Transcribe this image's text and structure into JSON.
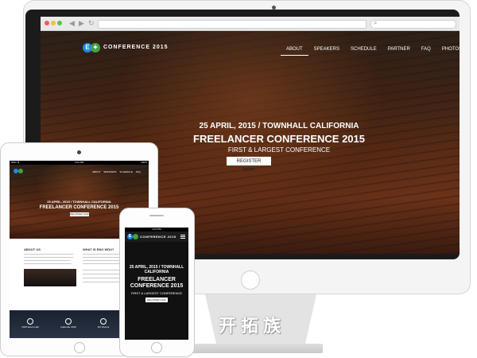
{
  "desktop": {
    "logo": {
      "badge": "E",
      "text": "CONFERENCE 2015"
    },
    "nav": [
      "ABOUT",
      "SPEAKERS",
      "SCHEDULE",
      "PARTNER",
      "FAQ",
      "PHOTOS"
    ],
    "hero": {
      "date_line": "25 APRIL, 2015 / TOWNHALL CALIFORNIA",
      "title": "FREELANCER CONFERENCE 2015",
      "subtitle": "FIRST & LARGEST CONFERENCE",
      "cta": "REGISTER NOW"
    }
  },
  "tablet": {
    "status": {
      "left": "iPAD 令",
      "time": "4:21 PM",
      "right": "100%"
    },
    "hero": {
      "date_line": "25 APRIL, 2015 / TOWNHALL CALIFORNIA",
      "title": "FREELANCER CONFERENCE 2015",
      "cta": "REGISTER NOW"
    },
    "sections": {
      "left": "ABOUT US",
      "right": "WHAT IS ENG WDU?"
    },
    "features": [
      "2015 Event Hall",
      "Calendar 2015",
      "3/2 Rooms"
    ]
  },
  "phone": {
    "status": {
      "time": "4:21 PM"
    },
    "logo": {
      "badge": "E",
      "text": "CONFERENCE 2015"
    },
    "hero": {
      "date_line": "25 APRIL, 2015 / TOWNHALL CALIFORNIA",
      "title": "FREELANCER CONFERENCE 2015",
      "subtitle": "FIRST & LARGEST CONFERENCE",
      "cta": "REGISTER NOW"
    }
  },
  "watermark": "开拓族",
  "colors": {
    "logo_blue": "#1e88e5",
    "logo_green": "#43a047"
  }
}
